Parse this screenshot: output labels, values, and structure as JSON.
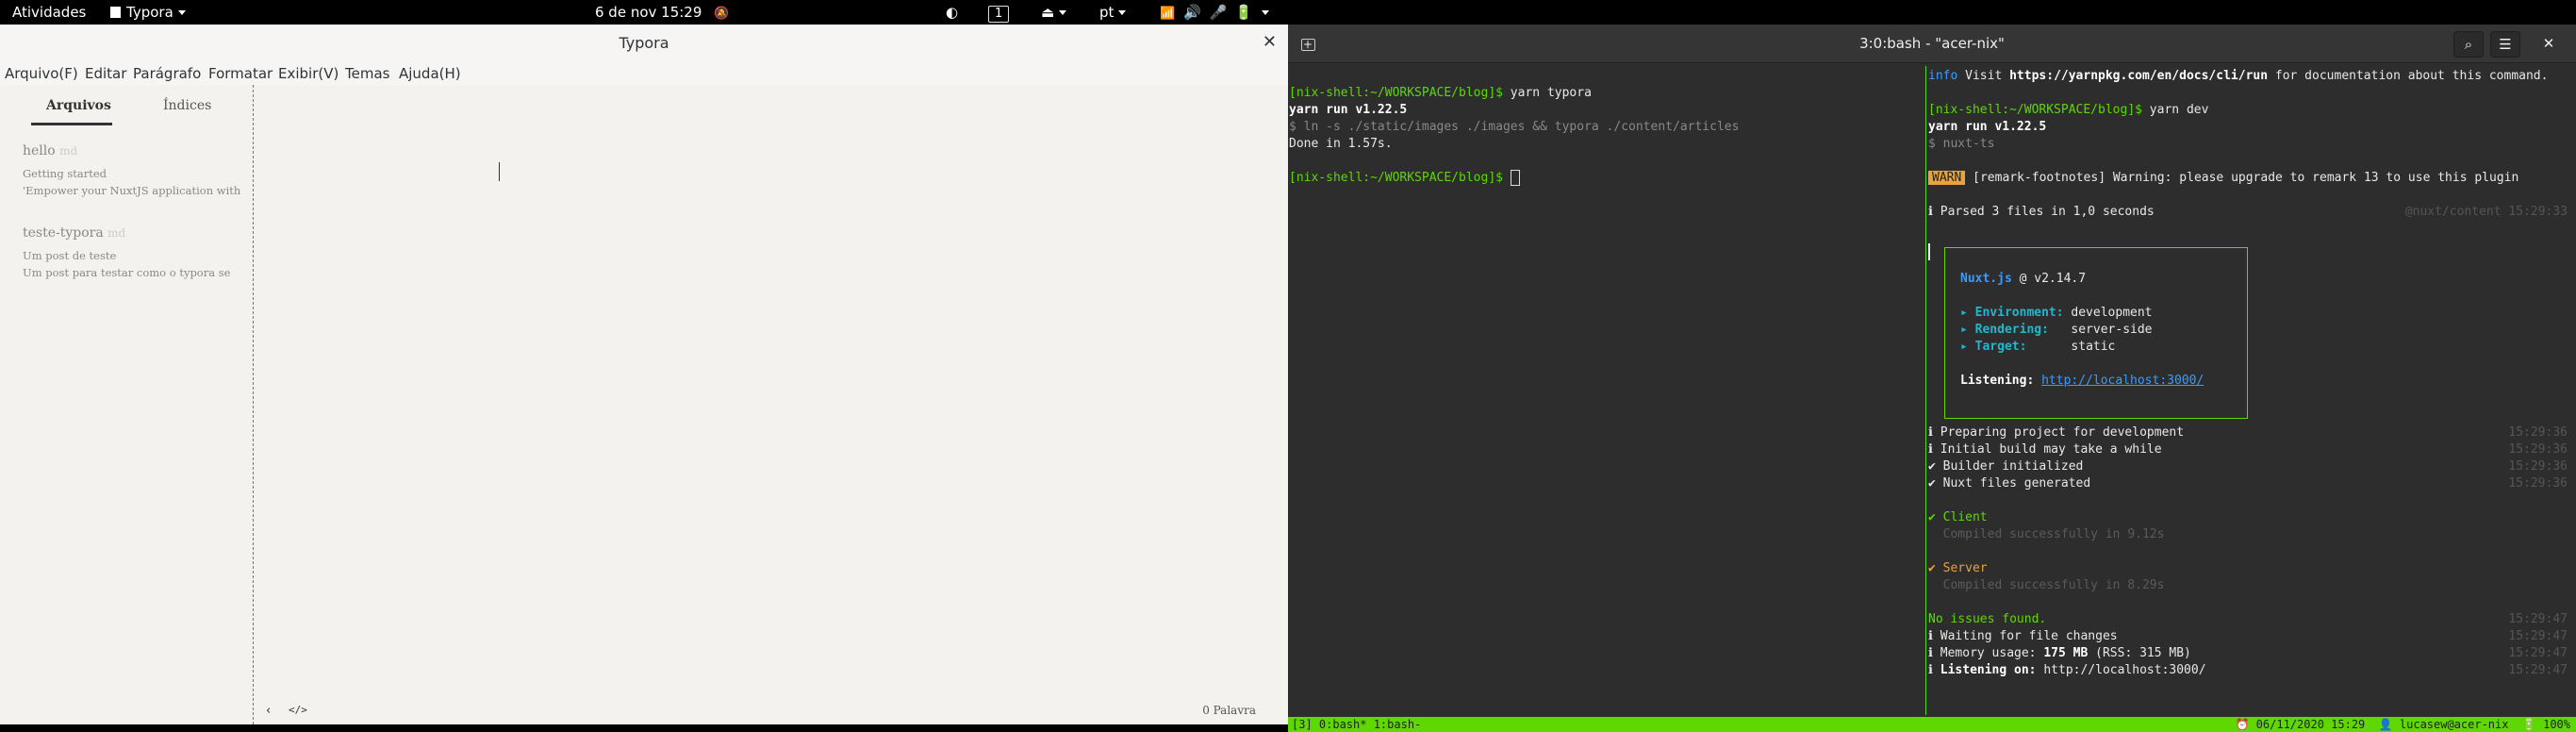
{
  "topbar": {
    "activities": "Atividades",
    "app_name": "Typora",
    "clock": "6 de nov  15:29",
    "workspace": "1",
    "language": "pt"
  },
  "typora": {
    "title": "Typora",
    "menu": [
      "Arquivo(F)",
      "Editar",
      "Parágrafo",
      "Formatar",
      "Exibir(V)",
      "Temas",
      "Ajuda(H)"
    ],
    "sidebar": {
      "tab_files": "Arquivos",
      "tab_outline": "Índices",
      "files": [
        {
          "name": "hello",
          "ext": "md",
          "line1": "Getting started",
          "line2": "'Empower your NuxtJS application with"
        },
        {
          "name": "teste-typora",
          "ext": "md",
          "line1": "Um post de teste",
          "line2": "Um post para testar como o typora se"
        }
      ]
    },
    "word_count": "0 Palavra"
  },
  "terminal": {
    "title": "3:0:bash - \"acer-nix\"",
    "left_pane": {
      "prompt1": "[nix-shell:~/WORKSPACE/blog]$",
      "cmd1": " yarn typora",
      "line2": "yarn run v1.22.5",
      "line3": "$ ln -s ./static/images ./images && typora ./content/articles",
      "line4": "Done in 1.57s.",
      "prompt2": "[nix-shell:~/WORKSPACE/blog]$"
    },
    "right_pane": {
      "info_tag": "info",
      "info_pre": " Visit ",
      "info_url": "https://yarnpkg.com/en/docs/cli/run",
      "info_post": " for documentation about this command.",
      "prompt": "[nix-shell:~/WORKSPACE/blog]$",
      "cmd": " yarn dev",
      "yarn_version": "yarn run v1.22.5",
      "nuxt_ts": "$ nuxt-ts",
      "warn_tag": "WARN",
      "warn_text": " [remark-footnotes] Warning: please upgrade to remark 13 to use this plugin",
      "parsed": "ℹ Parsed 3 files in 1,0 seconds",
      "parsed_src": "@nuxt/content 15:29:33",
      "box": {
        "brand": "Nuxt.js",
        "version": " @ v2.14.7",
        "env_label": "▸ Environment:",
        "env_value": " development",
        "render_label": "▸ Rendering:",
        "render_value": "   server-side",
        "target_label": "▸ Target:",
        "target_value": "      static",
        "listening_label": "Listening:",
        "listening_url": "http://localhost:3000/"
      },
      "log1": "ℹ Preparing project for development",
      "log2": "ℹ Initial build may take a while",
      "log3": "✔ Builder initialized",
      "log4": "✔ Nuxt files generated",
      "log_ts1": "15:29:36",
      "client": "✔ Client",
      "client_msg": "  Compiled successfully in 9.12s",
      "server": "✔ Server",
      "server_msg": "  Compiled successfully in 8.29s",
      "no_issues": "No issues found.",
      "waiting": "ℹ Waiting for file changes",
      "memory_pre": "ℹ Memory usage: ",
      "memory_val": "175 MB",
      "memory_post": " (RSS: 315 MB)",
      "listen_pre": "ℹ ",
      "listen_label": "Listening on:",
      "listen_url": " http://localhost:3000/",
      "log_ts2": "15:29:47"
    },
    "status_left": "[3] 0:bash* 1:bash-",
    "status_right": "⏰ 06/11/2020 15:29  👤 lucasew@acer-nix  🔋 100%"
  }
}
